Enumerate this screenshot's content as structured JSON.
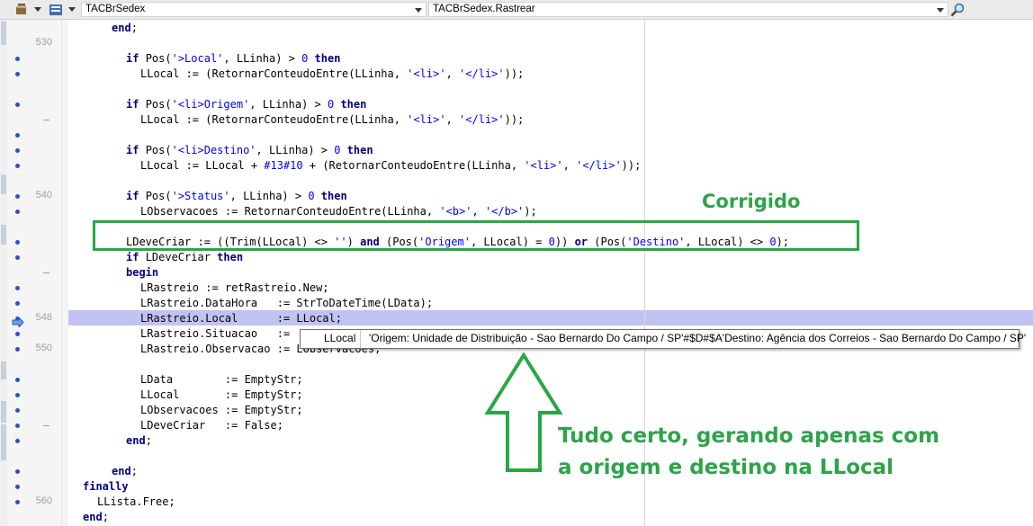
{
  "toolbar": {
    "unit_combo": "TACBrSedex",
    "method_combo": "TACBrSedex.Rastrear",
    "icons": [
      "unit-icon",
      "procedure-list-icon",
      "search-icon"
    ]
  },
  "line_numbers": [
    "530",
    "540",
    "548",
    "550",
    "560"
  ],
  "code": [
    {
      "i": 3,
      "t": [
        [
          "kw",
          "end"
        ],
        [
          "id",
          ";"
        ]
      ]
    },
    {
      "i": 0,
      "t": []
    },
    {
      "i": 4,
      "t": [
        [
          "kw",
          "if "
        ],
        [
          "id",
          "Pos("
        ],
        [
          "str",
          "'>Local'"
        ],
        [
          "id",
          ", LLinha) > "
        ],
        [
          "num",
          "0"
        ],
        [
          "kw",
          " then"
        ]
      ]
    },
    {
      "i": 5,
      "t": [
        [
          "id",
          "LLocal := (RetornarConteudoEntre(LLinha, "
        ],
        [
          "str",
          "'<li>'"
        ],
        [
          "id",
          ", "
        ],
        [
          "str",
          "'</li>'"
        ],
        [
          "id",
          "));"
        ]
      ]
    },
    {
      "i": 0,
      "t": []
    },
    {
      "i": 4,
      "t": [
        [
          "kw",
          "if "
        ],
        [
          "id",
          "Pos("
        ],
        [
          "str",
          "'<li>Origem'"
        ],
        [
          "id",
          ", LLinha) > "
        ],
        [
          "num",
          "0"
        ],
        [
          "kw",
          " then"
        ]
      ]
    },
    {
      "i": 5,
      "t": [
        [
          "id",
          "LLocal := (RetornarConteudoEntre(LLinha, "
        ],
        [
          "str",
          "'<li>'"
        ],
        [
          "id",
          ", "
        ],
        [
          "str",
          "'</li>'"
        ],
        [
          "id",
          "));"
        ]
      ]
    },
    {
      "i": 0,
      "t": []
    },
    {
      "i": 4,
      "t": [
        [
          "kw",
          "if "
        ],
        [
          "id",
          "Pos("
        ],
        [
          "str",
          "'<li>Destino'"
        ],
        [
          "id",
          ", LLinha) > "
        ],
        [
          "num",
          "0"
        ],
        [
          "kw",
          " then"
        ]
      ]
    },
    {
      "i": 5,
      "t": [
        [
          "id",
          "LLocal := LLocal + "
        ],
        [
          "num",
          "#13#10"
        ],
        [
          "id",
          " + (RetornarConteudoEntre(LLinha, "
        ],
        [
          "str",
          "'<li>'"
        ],
        [
          "id",
          ", "
        ],
        [
          "str",
          "'</li>'"
        ],
        [
          "id",
          "));"
        ]
      ]
    },
    {
      "i": 0,
      "t": []
    },
    {
      "i": 4,
      "t": [
        [
          "kw",
          "if "
        ],
        [
          "id",
          "Pos("
        ],
        [
          "str",
          "'>Status'"
        ],
        [
          "id",
          ", LLinha) > "
        ],
        [
          "num",
          "0"
        ],
        [
          "kw",
          " then"
        ]
      ]
    },
    {
      "i": 5,
      "t": [
        [
          "id",
          "LObservacoes := RetornarConteudoEntre(LLinha, "
        ],
        [
          "str",
          "'<b>'"
        ],
        [
          "id",
          ", "
        ],
        [
          "str",
          "'</b>'"
        ],
        [
          "id",
          ");"
        ]
      ]
    },
    {
      "i": 0,
      "t": []
    },
    {
      "i": 4,
      "t": [
        [
          "id",
          "LDeveCriar := ((Trim(LLocal) <> "
        ],
        [
          "str",
          "''"
        ],
        [
          "id",
          ") "
        ],
        [
          "kw",
          "and"
        ],
        [
          "id",
          " (Pos("
        ],
        [
          "str",
          "'Origem'"
        ],
        [
          "id",
          ", LLocal) = "
        ],
        [
          "num",
          "0"
        ],
        [
          "id",
          ")) "
        ],
        [
          "kw",
          "or"
        ],
        [
          "id",
          " (Pos("
        ],
        [
          "str",
          "'Destino'"
        ],
        [
          "id",
          ", LLocal) <> "
        ],
        [
          "num",
          "0"
        ],
        [
          "id",
          ");"
        ]
      ]
    },
    {
      "i": 4,
      "t": [
        [
          "kw",
          "if "
        ],
        [
          "id",
          "LDeveCriar "
        ],
        [
          "kw",
          "then"
        ]
      ]
    },
    {
      "i": 4,
      "t": [
        [
          "kw",
          "begin"
        ]
      ]
    },
    {
      "i": 5,
      "t": [
        [
          "id",
          "LRastreio := retRastreio.New;"
        ]
      ]
    },
    {
      "i": 5,
      "t": [
        [
          "id",
          "LRastreio.DataHora   := StrToDateTime(LData);"
        ]
      ]
    },
    {
      "i": 5,
      "t": [
        [
          "id",
          "LRastreio.Local      := LLocal;"
        ]
      ]
    },
    {
      "i": 5,
      "t": [
        [
          "id",
          "LRastreio.Situacao   := "
        ]
      ]
    },
    {
      "i": 5,
      "t": [
        [
          "id",
          "LRastreio.Observacao := LObservacoes;"
        ]
      ]
    },
    {
      "i": 0,
      "t": []
    },
    {
      "i": 5,
      "t": [
        [
          "id",
          "LData        := EmptyStr;"
        ]
      ]
    },
    {
      "i": 5,
      "t": [
        [
          "id",
          "LLocal       := EmptyStr;"
        ]
      ]
    },
    {
      "i": 5,
      "t": [
        [
          "id",
          "LObservacoes := EmptyStr;"
        ]
      ]
    },
    {
      "i": 5,
      "t": [
        [
          "id",
          "LDeveCriar   := False;"
        ]
      ]
    },
    {
      "i": 4,
      "t": [
        [
          "kw",
          "end"
        ],
        [
          "id",
          ";"
        ]
      ]
    },
    {
      "i": 0,
      "t": []
    },
    {
      "i": 3,
      "t": [
        [
          "kw",
          "end"
        ],
        [
          "id",
          ";"
        ]
      ]
    },
    {
      "i": 1,
      "t": [
        [
          "kw",
          "finally"
        ]
      ]
    },
    {
      "i": 2,
      "t": [
        [
          "id",
          "LLista.Free;"
        ]
      ]
    },
    {
      "i": 1,
      "t": [
        [
          "kw",
          "end"
        ],
        [
          "id",
          ";"
        ]
      ]
    }
  ],
  "tooltip": {
    "name": "LLocal",
    "value": "'Origem: Unidade de Distribuição - Sao Bernardo Do Campo / SP'#$D#$A'Destino: Agência dos Correios - Sao Bernardo Do Campo / SP'"
  },
  "annotations": {
    "corrected_label": "Corrigido",
    "note_line1": "Tudo certo, gerando apenas com",
    "note_line2": "a origem e destino na LLocal",
    "color": "#2da34a"
  }
}
